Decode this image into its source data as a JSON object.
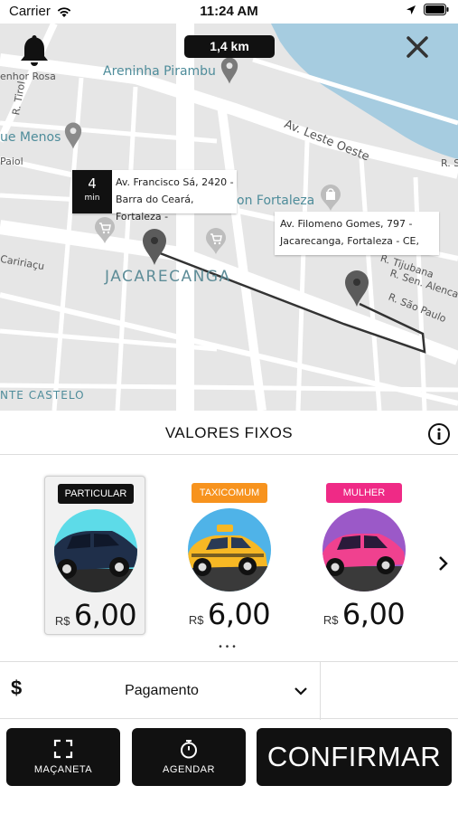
{
  "status_bar": {
    "carrier": "Carrier",
    "time": "11:24 AM"
  },
  "map": {
    "distance": "1,4 km",
    "labels": {
      "areninha": "Areninha Pirambu",
      "senhor_rosa": "enhor Rosa",
      "ue_menos": "ue Menos",
      "paiol": "Paiol",
      "av_leste_oeste": "Av. Leste Oeste",
      "r_s": "R. S",
      "on_fortaleza": "on Fortaleza",
      "cairiacu": "Caririaçu",
      "jacarecanga": "JACARECANGA",
      "r_tijubana": "R. Tijubana",
      "r_sen_alencar": "R. Sen. Alencar",
      "r_sao_paulo": "R. São Paulo",
      "monte_castelo": "NTE CASTELO",
      "r_tirol": "R. Tirol"
    },
    "origin": {
      "eta_value": "4",
      "eta_unit": "min",
      "line1": "Av. Francisco Sá, 2420 -",
      "line2": "Barra do Ceará, Fortaleza -"
    },
    "destination": {
      "line1": "Av. Filomeno Gomes, 797 -",
      "line2": "Jacarecanga, Fortaleza - CE,"
    }
  },
  "section_title": "VALORES FIXOS",
  "categories": [
    {
      "name": "PARTICULAR",
      "currency": "R$",
      "price": "6,00",
      "badge_color": "#111111",
      "selected": true
    },
    {
      "name": "TAXICOMUM",
      "currency": "R$",
      "price": "6,00",
      "badge_color": "#f7931e",
      "selected": false
    },
    {
      "name": "MULHER",
      "currency": "R$",
      "price": "6,00",
      "badge_color": "#ef2a86",
      "selected": false
    }
  ],
  "pager_dots": "•••",
  "payment": {
    "symbol": "$",
    "label": "Pagamento"
  },
  "actions": {
    "macaneta": "MAÇANETA",
    "agendar": "AGENDAR",
    "confirmar": "CONFIRMAR"
  }
}
